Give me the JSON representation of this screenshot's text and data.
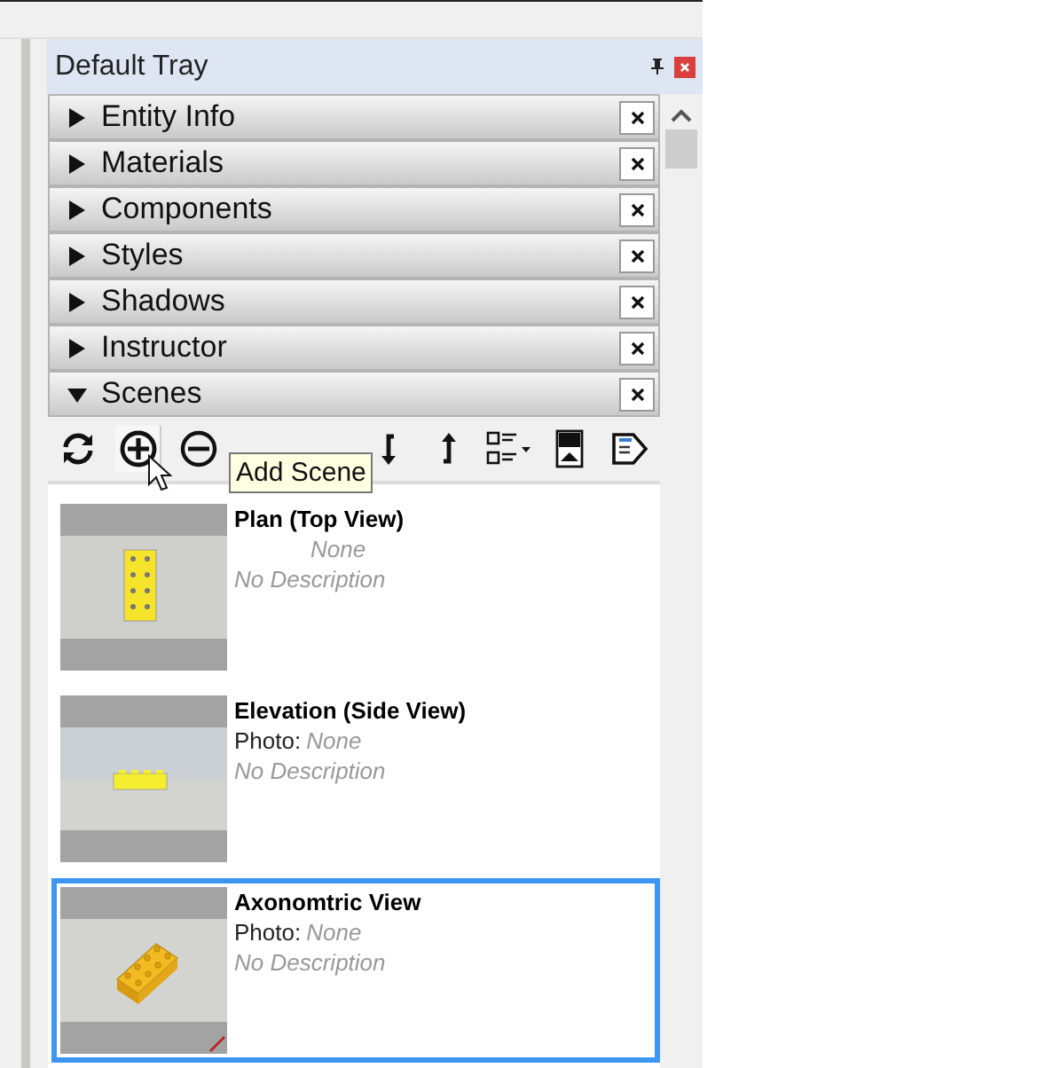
{
  "window": {
    "title": "Default Tray"
  },
  "panels": [
    {
      "title": "Entity Info",
      "expanded": false
    },
    {
      "title": "Materials",
      "expanded": false
    },
    {
      "title": "Components",
      "expanded": false
    },
    {
      "title": "Styles",
      "expanded": false
    },
    {
      "title": "Shadows",
      "expanded": false
    },
    {
      "title": "Instructor",
      "expanded": false
    },
    {
      "title": "Scenes",
      "expanded": true
    }
  ],
  "tooltip": "Add Scene",
  "scenes": [
    {
      "kind": "plan",
      "title": "Plan (Top View)",
      "photo_value": "None",
      "description": "No Description",
      "selected": false
    },
    {
      "kind": "elevation",
      "title": "Elevation (Side View)",
      "photo_label": "Photo:",
      "photo_value": "None",
      "description": "No Description",
      "selected": false
    },
    {
      "kind": "axonometric",
      "title": "Axonomtric View",
      "photo_label": "Photo:",
      "photo_value": "None",
      "description": "No Description",
      "selected": true
    }
  ]
}
